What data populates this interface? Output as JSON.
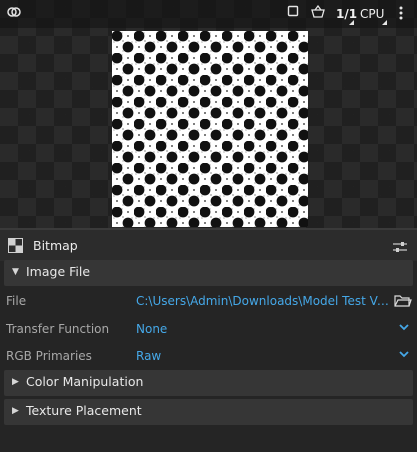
{
  "toolbar": {
    "zoom_ratio": "1/1",
    "device": "CPU",
    "more_icon": "kebab-menu-icon",
    "link_icon": "link-icon",
    "square_icon": "square-icon",
    "basket_icon": "basket-icon"
  },
  "panel": {
    "title": "Bitmap",
    "settings_icon": "sliders-icon",
    "sections": {
      "image_file": "Image File",
      "color_manipulation": "Color Manipulation",
      "texture_placement": "Texture Placement"
    },
    "properties": {
      "file_label": "File",
      "file_value": "C:\\Users\\Admin\\Downloads\\Model Test Vat ...",
      "transfer_function_label": "Transfer Function",
      "transfer_function_value": "None",
      "rgb_primaries_label": "RGB Primaries",
      "rgb_primaries_value": "Raw"
    }
  },
  "colors": {
    "accent": "#45a8e8",
    "background": "#1e1e1e",
    "section_header": "#363636"
  }
}
